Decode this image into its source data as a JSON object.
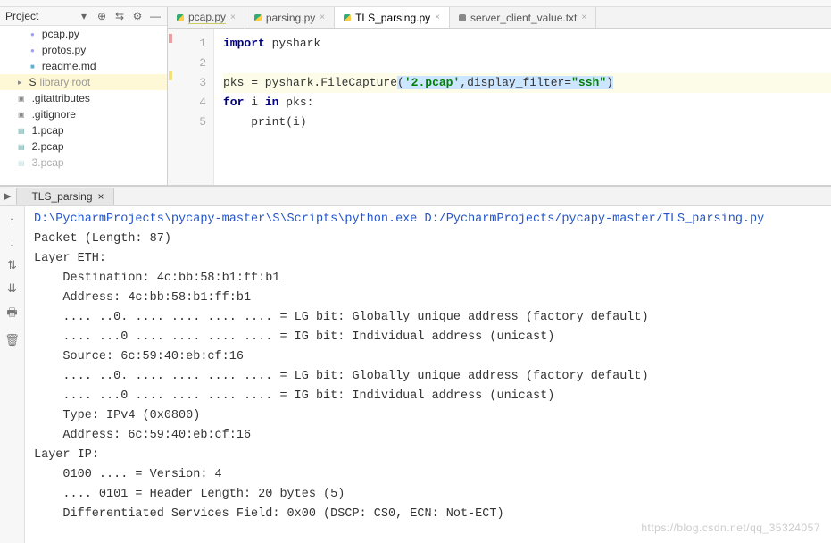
{
  "project_label": "Project",
  "tabs": [
    {
      "label": "pcap.py",
      "type": "py",
      "wavy": true,
      "active": false
    },
    {
      "label": "parsing.py",
      "type": "py",
      "wavy": false,
      "active": false
    },
    {
      "label": "TLS_parsing.py",
      "type": "py",
      "wavy": false,
      "active": true
    },
    {
      "label": "server_client_value.txt",
      "type": "txt",
      "wavy": false,
      "active": false
    }
  ],
  "tree": [
    {
      "label": "pcap.py",
      "cls": "fi-py deep"
    },
    {
      "label": "protos.py",
      "cls": "fi-py deep"
    },
    {
      "label": "readme.md",
      "cls": "fi-md deep"
    },
    {
      "label": "S",
      "suffix": "library root",
      "cls": "fi-fld sel",
      "gray": true
    },
    {
      "label": ".gitattributes",
      "cls": "fi-txt"
    },
    {
      "label": ".gitignore",
      "cls": "fi-txt"
    },
    {
      "label": "1.pcap",
      "cls": "fi-pc"
    },
    {
      "label": "2.pcap",
      "cls": "fi-pc"
    },
    {
      "label": "3.pcap",
      "cls": "fi-pc",
      "dim": true
    }
  ],
  "gutter": [
    "1",
    "2",
    "3",
    "4",
    "5"
  ],
  "code": {
    "l1": {
      "kw": "import",
      "rest": " pyshark"
    },
    "l3": {
      "pre": "pks = pyshark.FileCapture",
      "sel_open": "(",
      "str1": "'2.pcap'",
      "mid": ",display_filter=",
      "str2": "\"ssh\"",
      "sel_close": ")"
    },
    "l4": {
      "kw1": "for",
      "mid": " i ",
      "kw2": "in",
      "rest": " pks:"
    },
    "l5": {
      "pre": "    print(i)"
    }
  },
  "run": {
    "tab": "TLS_parsing",
    "cmd": "D:\\PycharmProjects\\pycapy-master\\S\\Scripts\\python.exe D:/PycharmProjects/pycapy-master/TLS_parsing.py",
    "lines": [
      "Packet (Length: 87)",
      "Layer ETH:",
      "    Destination: 4c:bb:58:b1:ff:b1",
      "    Address: 4c:bb:58:b1:ff:b1",
      "    .... ..0. .... .... .... .... = LG bit: Globally unique address (factory default)",
      "    .... ...0 .... .... .... .... = IG bit: Individual address (unicast)",
      "    Source: 6c:59:40:eb:cf:16",
      "    .... ..0. .... .... .... .... = LG bit: Globally unique address (factory default)",
      "    .... ...0 .... .... .... .... = IG bit: Individual address (unicast)",
      "    Type: IPv4 (0x0800)",
      "    Address: 6c:59:40:eb:cf:16",
      "Layer IP:",
      "    0100 .... = Version: 4",
      "    .... 0101 = Header Length: 20 bytes (5)",
      "    Differentiated Services Field: 0x00 (DSCP: CS0, ECN: Not-ECT)"
    ]
  },
  "watermark": "https://blog.csdn.net/qq_35324057"
}
